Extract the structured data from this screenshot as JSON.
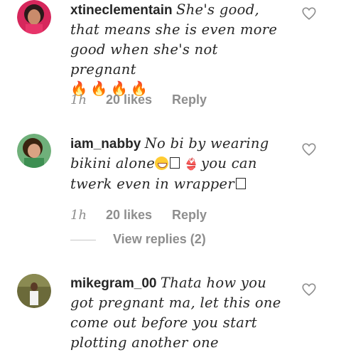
{
  "comments": [
    {
      "username": "xtineclementain",
      "text": "She's good, that means she is even more good when she's not pregnant",
      "emoji": "🔥🔥🔥🔥",
      "time": "1h",
      "likes": "20 likes",
      "reply": "Reply"
    },
    {
      "username": "iam_nabby",
      "text_a": "No bi by wearing bikini alone",
      "text_b": "you can twerk even in wrapper",
      "time": "1h",
      "likes": "20 likes",
      "reply": "Reply",
      "view_replies": "View replies (2)"
    },
    {
      "username": "mikegram_00",
      "text": "Thata how you got pregnant ma, let this one come out before you start plotting another one"
    }
  ],
  "icons": {
    "like": "heart-outline-icon"
  },
  "colors": {
    "text": "#262626",
    "meta": "#8e8e8e"
  }
}
